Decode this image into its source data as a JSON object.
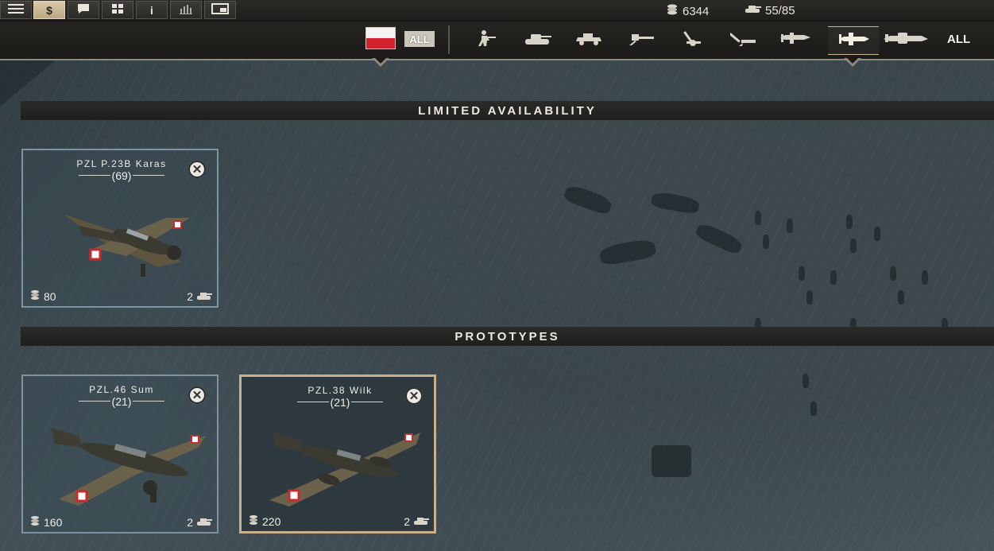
{
  "topbar": {
    "buttons": [
      {
        "name": "menu",
        "icon": "hamburger-icon"
      },
      {
        "name": "shop",
        "icon": "dollar-icon",
        "label": "$",
        "active": true
      },
      {
        "name": "chat",
        "icon": "chat-icon"
      },
      {
        "name": "grid",
        "icon": "grid-icon"
      },
      {
        "name": "info",
        "icon": "info-icon",
        "label": "i"
      },
      {
        "name": "stats",
        "icon": "bar-chart-icon"
      },
      {
        "name": "window",
        "icon": "window-icon"
      }
    ],
    "money": "6344",
    "army_slots": "55/85"
  },
  "filters": {
    "nation_flag": "poland-flag",
    "all_nations_label": "ALL",
    "categories": [
      {
        "name": "infantry",
        "icon": "infantry-icon"
      },
      {
        "name": "tank",
        "icon": "tank-icon"
      },
      {
        "name": "recon",
        "icon": "armored-car-icon"
      },
      {
        "name": "anti-tank",
        "icon": "anti-tank-gun-icon"
      },
      {
        "name": "artillery",
        "icon": "artillery-icon"
      },
      {
        "name": "anti-air",
        "icon": "anti-air-gun-icon"
      },
      {
        "name": "fighter",
        "icon": "fighter-plane-icon"
      },
      {
        "name": "bomber",
        "icon": "bomber-plane-icon",
        "active": true
      },
      {
        "name": "heavy-bomber",
        "icon": "heavy-bomber-icon"
      }
    ],
    "all_label": "ALL"
  },
  "sections": {
    "limited": "LIMITED AVAILABILITY",
    "prototypes": "PROTOTYPES"
  },
  "units": {
    "limited": [
      {
        "name": "PZL P.23B Karas",
        "count": "(69)",
        "cost": "80",
        "slots": "2",
        "selected": false
      }
    ],
    "prototypes": [
      {
        "name": "PZL.46 Sum",
        "count": "(21)",
        "cost": "160",
        "slots": "2",
        "selected": false
      },
      {
        "name": "PZL.38 Wilk",
        "count": "(21)",
        "cost": "220",
        "slots": "2",
        "selected": true
      }
    ]
  },
  "colors": {
    "accent": "#c8b08a",
    "card_border": "#7f93a0",
    "flag_red": "#d3202e"
  }
}
